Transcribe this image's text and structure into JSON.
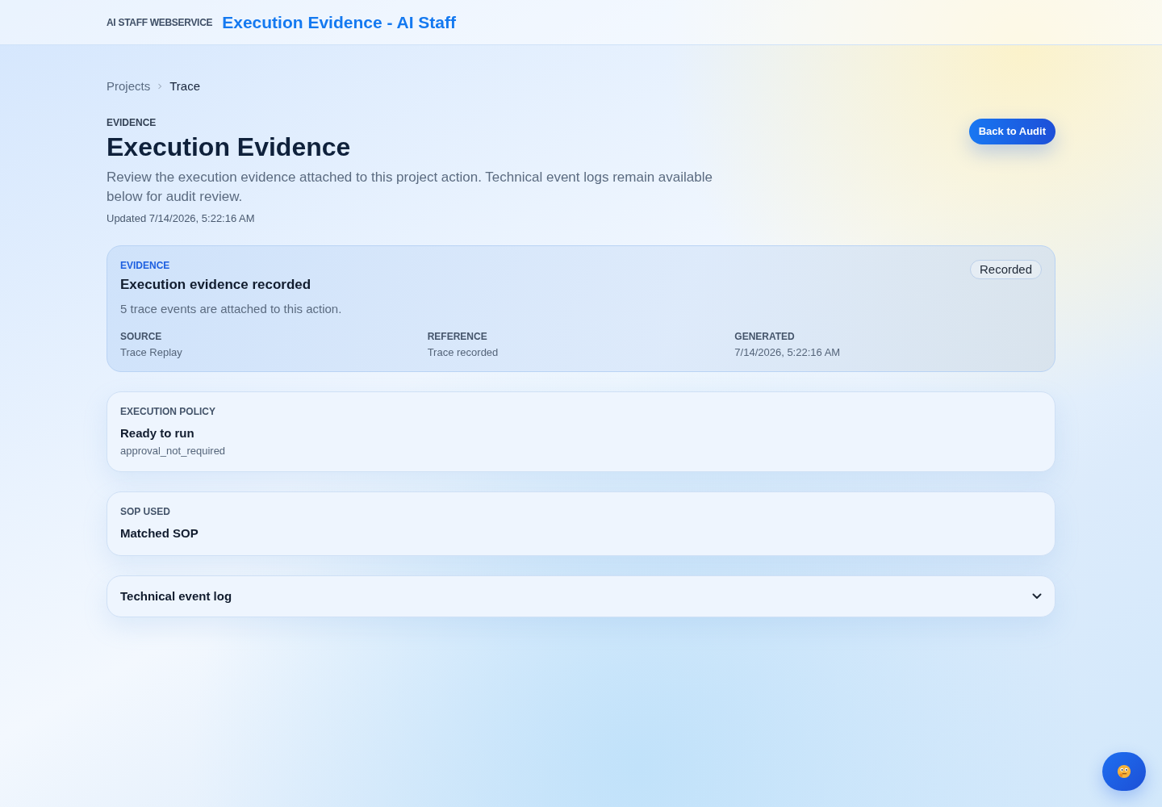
{
  "header": {
    "brand": "AI STAFF WEBSERVICE",
    "title": "Execution Evidence - AI Staff"
  },
  "breadcrumb": [
    {
      "label": "Projects",
      "current": false
    },
    {
      "label": "Trace",
      "current": true
    }
  ],
  "page": {
    "eyebrow": "EVIDENCE",
    "title": "Execution Evidence",
    "description": "Review the execution evidence attached to this project action. Technical event logs remain available below for audit review.",
    "updated": "Updated 7/14/2026, 5:22:16 AM",
    "action": "Back to Audit"
  },
  "evidence_card": {
    "eyebrow": "EVIDENCE",
    "title": "Execution evidence recorded",
    "summary": "5 trace events are attached to this action.",
    "badge": "Recorded",
    "fields": [
      {
        "label": "SOURCE",
        "value": "Trace Replay"
      },
      {
        "label": "REFERENCE",
        "value": "Trace recorded"
      },
      {
        "label": "GENERATED",
        "value": "7/14/2026, 5:22:16 AM"
      }
    ]
  },
  "sections": [
    {
      "kind": "info",
      "label": "EXECUTION POLICY",
      "title": "Ready to run",
      "detail": "approval_not_required"
    },
    {
      "kind": "info",
      "label": "SOP USED",
      "title": "Matched SOP"
    },
    {
      "kind": "collapsible",
      "title": "Technical event log",
      "expanded": false
    }
  ]
}
